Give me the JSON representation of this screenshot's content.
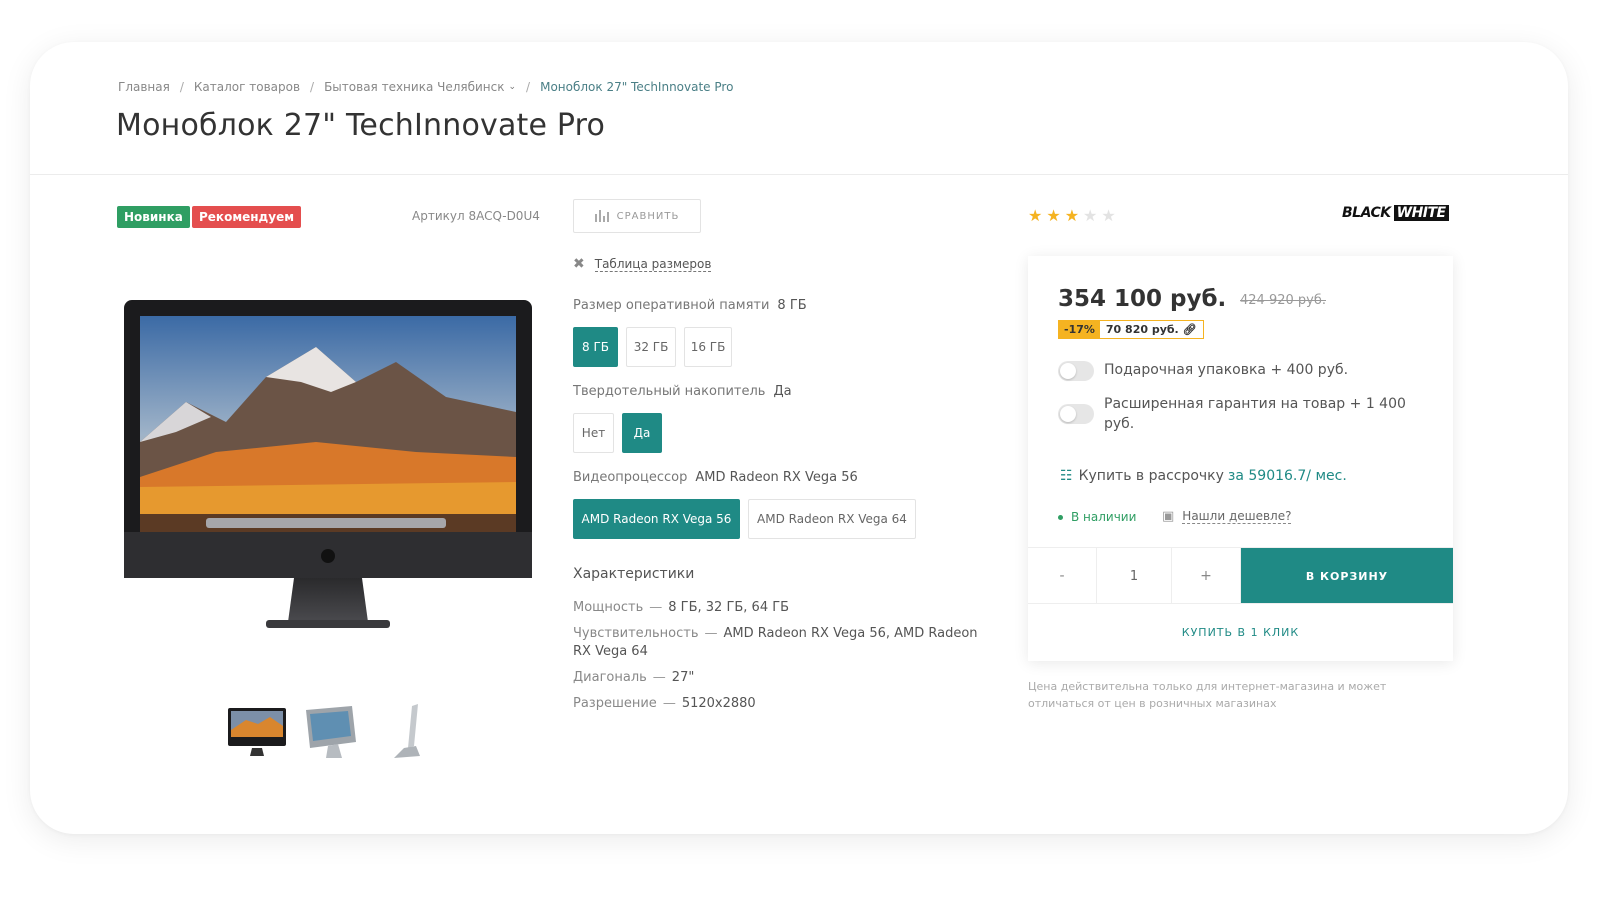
{
  "breadcrumb": {
    "items": [
      "Главная",
      "Каталог товаров",
      "Бытовая техника Челябинск",
      "Моноблок 27\" TechInnovate Pro"
    ],
    "separator": "/"
  },
  "page_title": "Моноблок 27\" TechInnovate Pro",
  "badges": {
    "new": "Новинка",
    "recommended": "Рекомендуем"
  },
  "sku": "Артикул 8ACQ-D0U4",
  "compare_label": "СРАВНИТЬ",
  "sizes_table_label": "Таблица размеров",
  "options": {
    "ram": {
      "label": "Размер оперативной памяти",
      "selected": "8 ГБ",
      "values": [
        "8 ГБ",
        "32 ГБ",
        "16 ГБ"
      ],
      "active_index": 0
    },
    "ssd": {
      "label": "Твердотельный накопитель",
      "selected": "Да",
      "values": [
        "Нет",
        "Да"
      ],
      "active_index": 1
    },
    "gpu": {
      "label": "Видеопроцессор",
      "selected": "AMD Radeon RX Vega 56",
      "values": [
        "AMD Radeon RX Vega 56",
        "AMD Radeon RX Vega 64"
      ],
      "active_index": 0
    }
  },
  "specs": {
    "title": "Характеристики",
    "items": [
      {
        "key": "Мощность",
        "value": "8 ГБ, 32 ГБ, 64 ГБ"
      },
      {
        "key": "Чувствительность",
        "value": "AMD Radeon RX Vega 56, AMD Radeon RX Vega 64"
      },
      {
        "key": "Диагональ",
        "value": "27\""
      },
      {
        "key": "Разрешение",
        "value": "5120x2880"
      }
    ],
    "separator": "—"
  },
  "rating": {
    "value": 3,
    "max": 5
  },
  "brand": {
    "part1": "BLACK",
    "part2": "WHITE"
  },
  "price": {
    "current": "354 100 руб.",
    "old": "424 920 руб.",
    "discount_percent": "-17%",
    "discount_amount": "70 820 руб."
  },
  "extras": {
    "gift_wrap": "Подарочная упаковка + 400 руб.",
    "warranty": "Расширенная гарантия на товар + 1 400 руб."
  },
  "installment": {
    "text": "Купить в рассрочку",
    "link": "за 59016.7/ мес."
  },
  "availability": "В наличии",
  "cheaper_link": "Нашли дешевле?",
  "quantity": {
    "minus": "-",
    "value": "1",
    "plus": "+"
  },
  "cart_button": "В КОРЗИНУ",
  "one_click": "КУПИТЬ В 1 КЛИК",
  "price_note": "Цена действительна только для интернет-магазина и может отличаться от цен в розничных магазинах",
  "colors": {
    "accent": "#1f8a85",
    "new_badge": "#2f9e63",
    "rec_badge": "#e44e4e",
    "star": "#f5b321"
  }
}
